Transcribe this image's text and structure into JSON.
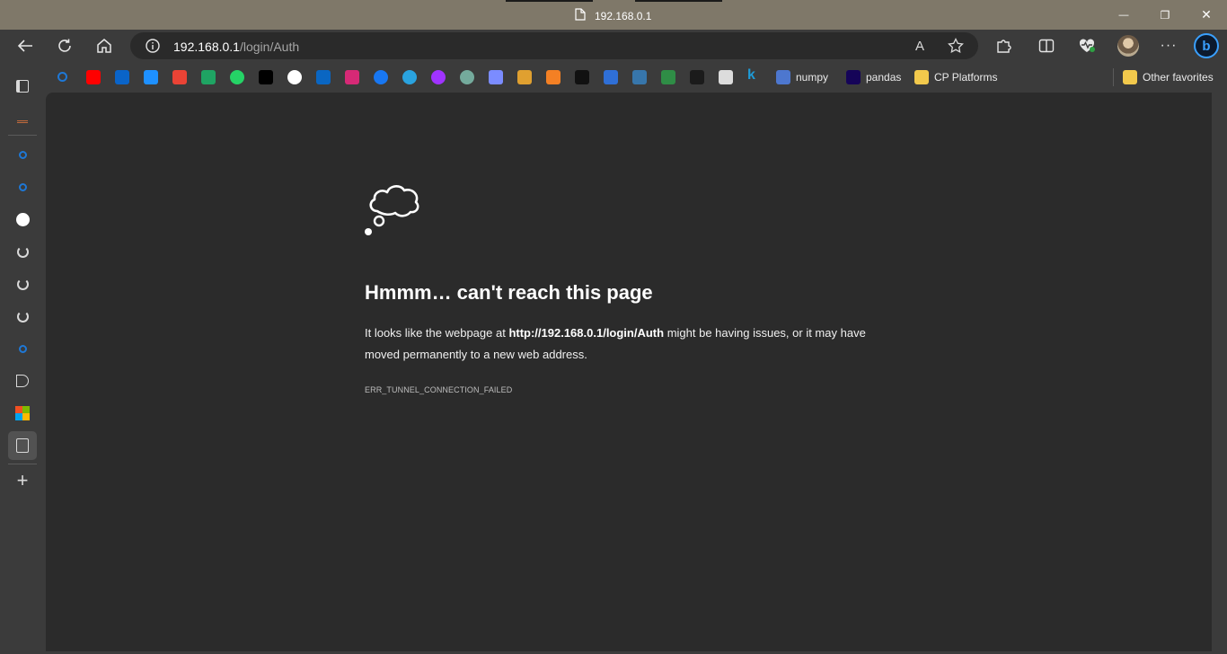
{
  "titlebar": {
    "title": "192.168.0.1",
    "minimize_glyph": "—",
    "restore_glyph": "❐",
    "close_glyph": "✕"
  },
  "toolbar": {
    "back_icon": "back-arrow-icon",
    "refresh_icon": "refresh-icon",
    "home_icon": "home-icon",
    "more_glyph": "···"
  },
  "address": {
    "host": "192.168.0.1",
    "path": "/login/Auth",
    "read_aloud_glyph": "A"
  },
  "favorites": {
    "items": [
      {
        "name": "search",
        "color": "#1e78d6"
      },
      {
        "name": "youtube",
        "color": "#ff0000"
      },
      {
        "name": "outlook",
        "color": "#0a64c9"
      },
      {
        "name": "onedrive",
        "color": "#1e90ff"
      },
      {
        "name": "gmail",
        "color": "#ea4335"
      },
      {
        "name": "google-drive",
        "color": "#1fa463"
      },
      {
        "name": "whatsapp",
        "color": "#25d366"
      },
      {
        "name": "x",
        "color": "#000000"
      },
      {
        "name": "github",
        "color": "#ffffff"
      },
      {
        "name": "linkedin",
        "color": "#0a66c2"
      },
      {
        "name": "instagram",
        "color": "#d62976"
      },
      {
        "name": "facebook",
        "color": "#1877f2"
      },
      {
        "name": "telegram",
        "color": "#2aa3df"
      },
      {
        "name": "messenger",
        "color": "#a033ff"
      },
      {
        "name": "chatgpt",
        "color": "#74aa9c"
      },
      {
        "name": "gemini",
        "color": "#7b8cff"
      },
      {
        "name": "codeforces",
        "color": "#e0a030"
      },
      {
        "name": "stackoverflow",
        "color": "#f48024"
      },
      {
        "name": "codeium",
        "color": "#111111"
      },
      {
        "name": "arc",
        "color": "#2f6fd6"
      },
      {
        "name": "python",
        "color": "#3776ab"
      },
      {
        "name": "geeks",
        "color": "#2f8d46"
      },
      {
        "name": "mt",
        "color": "#1b1b1b"
      },
      {
        "name": "notes",
        "color": "#dcdcdc"
      },
      {
        "name": "k",
        "color": "#1e9bd7"
      }
    ],
    "labeled": [
      {
        "label": "numpy",
        "color": "#4d77cf"
      },
      {
        "label": "pandas",
        "color": "#150458"
      },
      {
        "label": "CP Platforms",
        "color": "#f2c94c"
      }
    ],
    "other": {
      "label": "Other favorites",
      "color": "#f2c94c"
    }
  },
  "sidebar": {
    "items": [
      "tabs-icon",
      "stack-icon",
      "search-icon",
      "search-icon",
      "github-icon",
      "spinner-icon",
      "spinner-icon",
      "spinner-icon",
      "search-icon",
      "speaker-icon",
      "windows-icon",
      "document-icon"
    ],
    "add_glyph": "+"
  },
  "error": {
    "title": "Hmmm… can't reach this page",
    "body_before": "It looks like the webpage at ",
    "body_url": "http://192.168.0.1/login/Auth",
    "body_after": " might be having issues, or it may have moved permanently to a new web address.",
    "code": "ERR_TUNNEL_CONNECTION_FAILED"
  }
}
